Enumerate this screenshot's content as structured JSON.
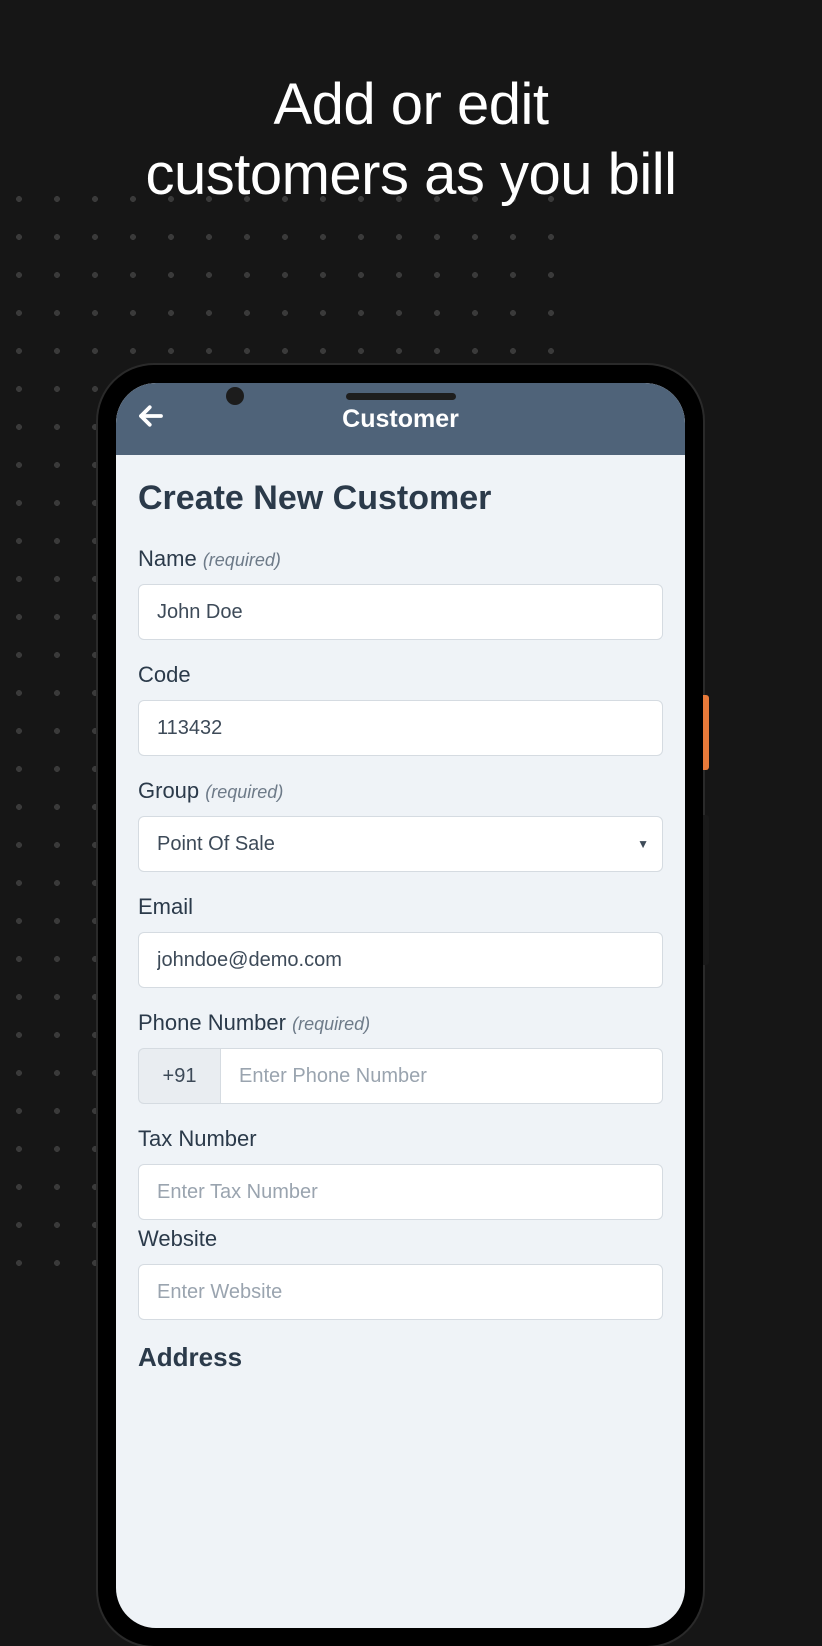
{
  "marketing": {
    "headline_line1": "Add or edit",
    "headline_line2": "customers as you bill"
  },
  "header": {
    "title": "Customer"
  },
  "page": {
    "title": "Create New Customer"
  },
  "required_suffix": "(required)",
  "fields": {
    "name": {
      "label": "Name",
      "value": "John Doe",
      "required": true
    },
    "code": {
      "label": "Code",
      "value": "113432",
      "required": false
    },
    "group": {
      "label": "Group",
      "value": "Point Of Sale",
      "required": true
    },
    "email": {
      "label": "Email",
      "value": "johndoe@demo.com",
      "required": false
    },
    "phone": {
      "label": "Phone Number",
      "prefix": "+91",
      "placeholder": "Enter Phone Number",
      "required": true
    },
    "tax": {
      "label": "Tax Number",
      "placeholder": "Enter Tax Number",
      "required": false
    },
    "website": {
      "label": "Website",
      "placeholder": "Enter Website",
      "required": false
    },
    "address": {
      "label": "Address"
    }
  }
}
